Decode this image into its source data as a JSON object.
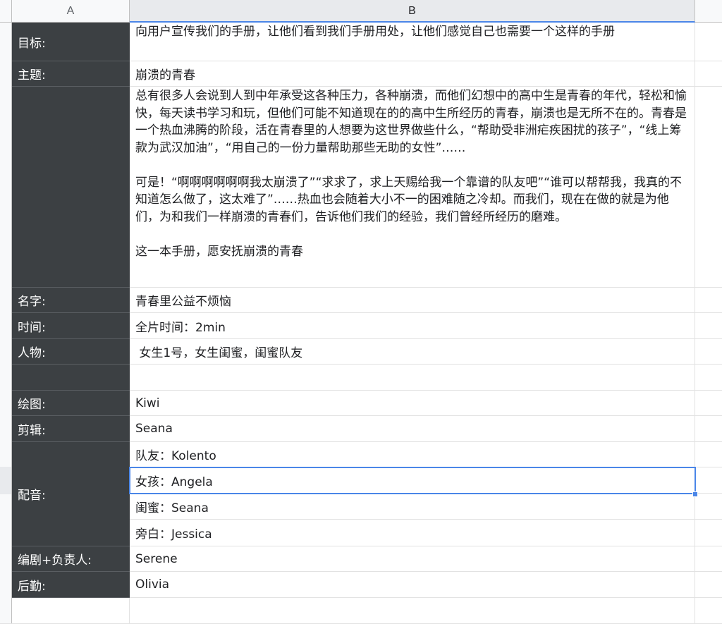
{
  "sheet": {
    "columns": [
      {
        "label": "A"
      },
      {
        "label": "B"
      }
    ],
    "rows": [
      {
        "label": "目标:",
        "value": "向用户宣传我们的手册，让他们看到我们手册用处，让他们感觉自己也需要一个这样的手册"
      },
      {
        "label": "主题:",
        "value": "崩溃的青春"
      },
      {
        "label": "",
        "value": "总有很多人会说到人到中年承受这各种压力，各种崩溃，而他们幻想中的高中生是青春的年代，轻松和愉快，每天读书学习和玩，但他们可能不知道现在的的高中生所经历的青春，崩溃也是无所不在的。青春是一个热血沸腾的阶段，活在青春里的人想要为这世界做些什么，“帮助受非洲疟疾困扰的孩子”，“线上筹款为武汉加油”，“用自己的一份力量帮助那些无助的女性”……\n\n可是！“啊啊啊啊啊啊我太崩溃了”“求求了，求上天赐给我一个靠谱的队友吧”“谁可以帮帮我，我真的不知道怎么做了，这太难了”……热血也会随着大小不一的困难随之冷却。而我们，现在在做的就是为他们，为和我们一样崩溃的青春们，告诉他们我们的经验，我们曾经所经历的磨难。\n\n这一本手册，愿安抚崩溃的青春"
      },
      {
        "label": "名字:",
        "value": "青春里公益不烦恼"
      },
      {
        "label": "时间:",
        "value": "全片时间：2min"
      },
      {
        "label": "人物:",
        "value": " 女生1号，女生闺蜜，闺蜜队友"
      },
      {
        "label": "",
        "value": ""
      },
      {
        "label": "绘图:",
        "value": "Kiwi"
      },
      {
        "label": "剪辑:",
        "value": "Seana"
      },
      {
        "label": "配音:",
        "value": ""
      },
      {
        "label": "编剧+负责人:",
        "value": "Serene"
      },
      {
        "label": "后勤:",
        "value": "Olivia"
      }
    ],
    "voice_cast": [
      "队友：Kolento",
      "女孩：Angela",
      "闺蜜：Seana",
      "旁白：Jessica"
    ],
    "selected_cell_value": "女孩：Angela"
  },
  "colors": {
    "label_bg": "#3c4043",
    "label_text": "#ffffff",
    "selection": "#4a86e8",
    "header_bg": "#f8f9fa"
  }
}
